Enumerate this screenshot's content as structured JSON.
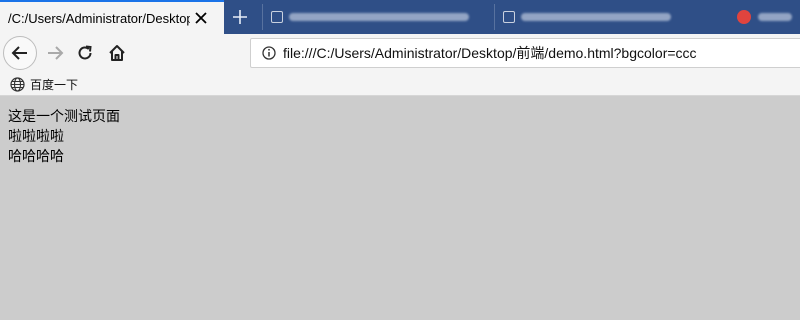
{
  "tab": {
    "title": "/C:/Users/Administrator/Desktop"
  },
  "address_bar": {
    "url": "file:///C:/Users/Administrator/Desktop/前端/demo.html?bgcolor=ccc"
  },
  "bookmarks": [
    {
      "label": "百度一下"
    }
  ],
  "page": {
    "background": "#cccccc",
    "lines": [
      "这是一个测试页面",
      "啦啦啦啦",
      "哈哈哈哈"
    ]
  },
  "colors": {
    "tabstrip": "#2f4f87",
    "accent": "#1a73e8",
    "chrome": "#f4f4f4"
  }
}
